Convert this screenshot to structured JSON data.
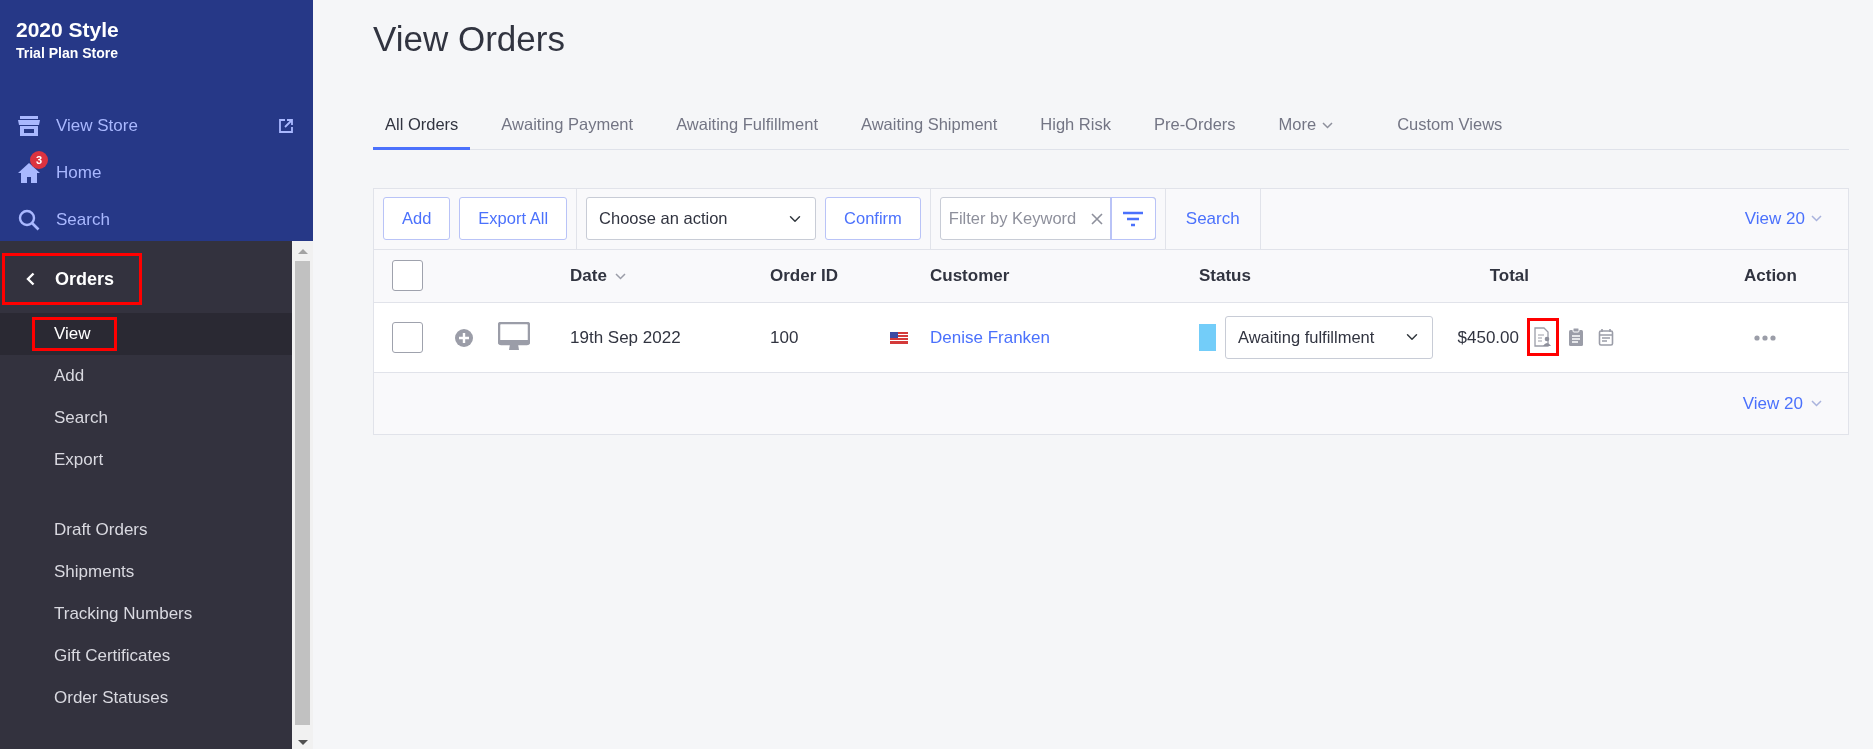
{
  "sidebar": {
    "store_name": "2020 Style",
    "store_plan": "Trial Plan Store",
    "top_items": [
      {
        "kind": "store",
        "label": "View Store",
        "external": true
      },
      {
        "kind": "home",
        "label": "Home",
        "badge": "3",
        "external": false
      },
      {
        "kind": "search",
        "label": "Search",
        "external": false
      }
    ],
    "section": {
      "label": "Orders",
      "highlighted": true
    },
    "item_groups": [
      {
        "items": [
          {
            "label": "View",
            "selected": true,
            "highlighted": true
          },
          {
            "label": "Add",
            "selected": false,
            "highlighted": false
          },
          {
            "label": "Search",
            "selected": false,
            "highlighted": false
          },
          {
            "label": "Export",
            "selected": false,
            "highlighted": false
          }
        ]
      },
      {
        "items": [
          {
            "label": "Draft Orders",
            "selected": false,
            "highlighted": false
          },
          {
            "label": "Shipments",
            "selected": false,
            "highlighted": false
          },
          {
            "label": "Tracking Numbers",
            "selected": false,
            "highlighted": false
          },
          {
            "label": "Gift Certificates",
            "selected": false,
            "highlighted": false
          },
          {
            "label": "Order Statuses",
            "selected": false,
            "highlighted": false
          }
        ]
      }
    ]
  },
  "page_title": "View Orders",
  "tabs": [
    {
      "label": "All Orders",
      "selected": true,
      "has_menu": false
    },
    {
      "label": "Awaiting Payment",
      "selected": false,
      "has_menu": false
    },
    {
      "label": "Awaiting Fulfillment",
      "selected": false,
      "has_menu": false
    },
    {
      "label": "Awaiting Shipment",
      "selected": false,
      "has_menu": false
    },
    {
      "label": "High Risk",
      "selected": false,
      "has_menu": false
    },
    {
      "label": "Pre-Orders",
      "selected": false,
      "has_menu": false
    },
    {
      "label": "More",
      "selected": false,
      "has_menu": true
    },
    {
      "label": "Custom Views",
      "selected": false,
      "has_menu": false
    }
  ],
  "toolbar": {
    "buttons": [
      "Add",
      "Export All"
    ],
    "action_select": "Choose an action",
    "confirm": "Confirm",
    "filter": {
      "placeholder": "Filter by Keyword"
    },
    "search": "Search",
    "view_count": "View 20"
  },
  "table": {
    "select_all": {
      "checked": false
    },
    "columns": [
      {
        "label": "Date",
        "sortable": true
      },
      {
        "label": "Order ID",
        "sortable": false
      },
      {
        "label": "Customer",
        "sortable": false
      },
      {
        "label": "Status",
        "sortable": false
      },
      {
        "label": "Total",
        "sortable": false
      },
      {
        "label": "Action",
        "sortable": false
      }
    ],
    "rows": [
      {
        "selected": false,
        "date": "19th Sep 2022",
        "order_id": "100",
        "customer": "Denise Franken",
        "status": {
          "value": "Awaiting fulfillment",
          "color": "#73cdf9"
        },
        "total": "$450.00",
        "order_icons": [
          {
            "kind": "invoice",
            "highlighted": true
          },
          {
            "kind": "clipboard",
            "highlighted": false
          },
          {
            "kind": "calendar",
            "highlighted": false
          }
        ]
      }
    ],
    "footer_view_count": "View 20"
  }
}
